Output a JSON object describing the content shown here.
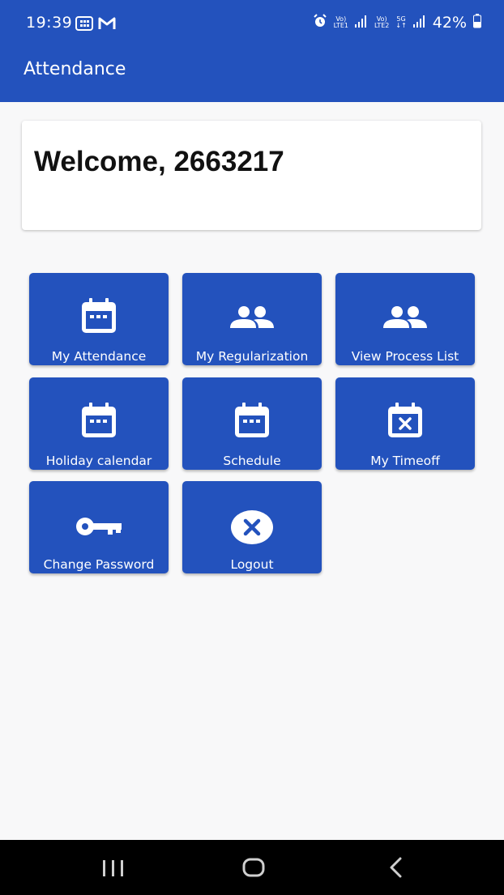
{
  "status_bar": {
    "time": "19:39",
    "sim1": "LTE1",
    "sim2": "LTE2",
    "network": "5G",
    "battery": "42%",
    "icons": [
      "calendar-grid-icon",
      "gmail-icon",
      "alarm-icon",
      "volte-icon",
      "signal-icon",
      "battery-icon"
    ]
  },
  "app_bar": {
    "title": "Attendance"
  },
  "welcome": {
    "text": "Welcome, 2663217"
  },
  "tiles": [
    {
      "label": "My Attendance",
      "icon": "calendar-icon"
    },
    {
      "label": "My Regularization",
      "icon": "people-icon"
    },
    {
      "label": "View Process List",
      "icon": "people-icon"
    },
    {
      "label": "Holiday calendar",
      "icon": "calendar-icon"
    },
    {
      "label": "Schedule",
      "icon": "calendar-icon"
    },
    {
      "label": "My Timeoff",
      "icon": "calendar-x-icon"
    },
    {
      "label": "Change Password",
      "icon": "key-icon"
    },
    {
      "label": "Logout",
      "icon": "close-circle-icon"
    }
  ],
  "nav_bar": {
    "buttons": [
      "recents-icon",
      "home-icon",
      "back-icon"
    ]
  },
  "colors": {
    "primary": "#2352bd",
    "background": "#f8f8f9",
    "card": "#ffffff"
  }
}
